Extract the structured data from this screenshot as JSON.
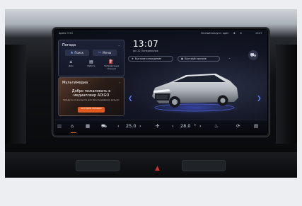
{
  "status_bar": {
    "left": "Apollo ☷ 5G",
    "right": "Личный аккаунт: один",
    "time": "13:07"
  },
  "weather_panel": {
    "title": "Погода",
    "buttons": [
      {
        "icon": "person-icon",
        "label": "Поиск"
      },
      {
        "icon": "tv-icon",
        "label": "Меню"
      }
    ],
    "shortcuts": [
      {
        "icon": "home-icon",
        "label": "Дом"
      },
      {
        "icon": "briefcase-icon",
        "label": "Работа"
      },
      {
        "icon": "fuel-icon",
        "label": "Заправочные станции"
      }
    ]
  },
  "media_panel": {
    "title": "Мультимедиа",
    "headline": "Добро пожаловать в медиаплеер ADIGO",
    "subtext": "Войдите из аккаунта для прослушивания музыки",
    "button": "ИСТОРИЯ МУЗЫКИ"
  },
  "clock": {
    "time": "13:07",
    "date": "Jan 22   Понедельник"
  },
  "quick_pills": [
    {
      "icon": "snowflake-icon",
      "label": "Быстрое охлаждение"
    },
    {
      "icon": "defrost-icon",
      "label": "Быстрый прогрев"
    }
  ],
  "dock": {
    "temp_left": "25.0",
    "temp_right": "28.0",
    "unit": "°"
  },
  "colors": {
    "accent": "#e36a2d",
    "highlight": "#5f7cff"
  }
}
